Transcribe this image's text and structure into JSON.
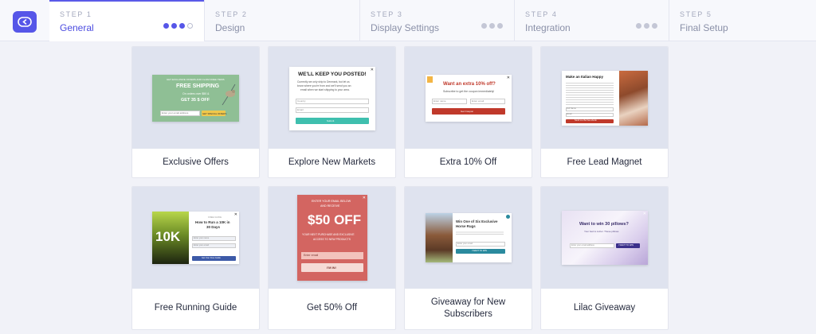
{
  "stepper": {
    "steps": [
      {
        "number": "STEP 1",
        "title": "General"
      },
      {
        "number": "STEP 2",
        "title": "Design"
      },
      {
        "number": "STEP 3",
        "title": "Display Settings"
      },
      {
        "number": "STEP 4",
        "title": "Integration"
      },
      {
        "number": "STEP 5",
        "title": "Final Setup"
      }
    ]
  },
  "templates": [
    {
      "name": "Exclusive Offers",
      "preview": {
        "line1": "GET EXCLUSIVE OFFERS AND CLAIM FREE ITEMS",
        "headline": "FREE SHIPPING",
        "sub": "On orders over $50 &",
        "offer": "GET 35 $ OFF",
        "placeholder": "Enter your email address",
        "button": "GET SPECIAL OFFERS"
      }
    },
    {
      "name": "Explore New Markets",
      "preview": {
        "headline": "WE'LL KEEP YOU POSTED!",
        "body1": "Currently we only ship to Denmark, but let us",
        "body2": "know where you're from and we'll send you an",
        "body3": "email when we start shipping to your area.",
        "field1": "Country",
        "field2": "Email",
        "button": "Submit"
      }
    },
    {
      "name": "Extra 10% Off",
      "preview": {
        "headline": "Want an extra 10% off?",
        "sub": "Subscribe to get the coupon immediately!",
        "field1": "Enter name",
        "field2": "Enter email",
        "button": "Get Coupon"
      }
    },
    {
      "name": "Free Lead Magnet",
      "preview": {
        "headline": "Make an Italian Happy",
        "field1": "Full Name",
        "field2": "Email",
        "button": "Send me the free ebook"
      }
    },
    {
      "name": "Free Running Guide",
      "preview": {
        "bg_text": "10K",
        "kicker": "FREE GUIDE",
        "headline1": "How to Run a 10K in",
        "headline2": "30 Days",
        "field1": "Enter your name",
        "field2": "Enter your email",
        "button": "Get Your Free Guide"
      }
    },
    {
      "name": "Get 50% Off",
      "preview": {
        "line1": "ENTER YOUR EMAIL BELOW",
        "line2": "AND RECEIVE",
        "headline": "$50 OFF",
        "line3": "YOUR NEXT PURCHASE AND EXCLUSIVE",
        "line4": "ACCESS TO NEW PRODUCTS",
        "placeholder": "Enter email",
        "button": "I'M IN!"
      }
    },
    {
      "name": "Giveaway for New Subscribers",
      "preview": {
        "headline1": "Win One of Six Exclusive",
        "headline2": "Horse Rugs",
        "field": "Enter your email",
        "button": "I WANT TO WIN"
      }
    },
    {
      "name": "Lilac Giveaway",
      "preview": {
        "headline": "Want to win 30 pillows?",
        "sub": "Your bed is cozier. These pillows",
        "placeholder": "Enter your email address",
        "button": "I WANT TO WIN"
      }
    }
  ],
  "colors": {
    "accent": "#5656e8",
    "lead_red": "#c0392b",
    "teal": "#3fbfae",
    "coral": "#d36561"
  }
}
